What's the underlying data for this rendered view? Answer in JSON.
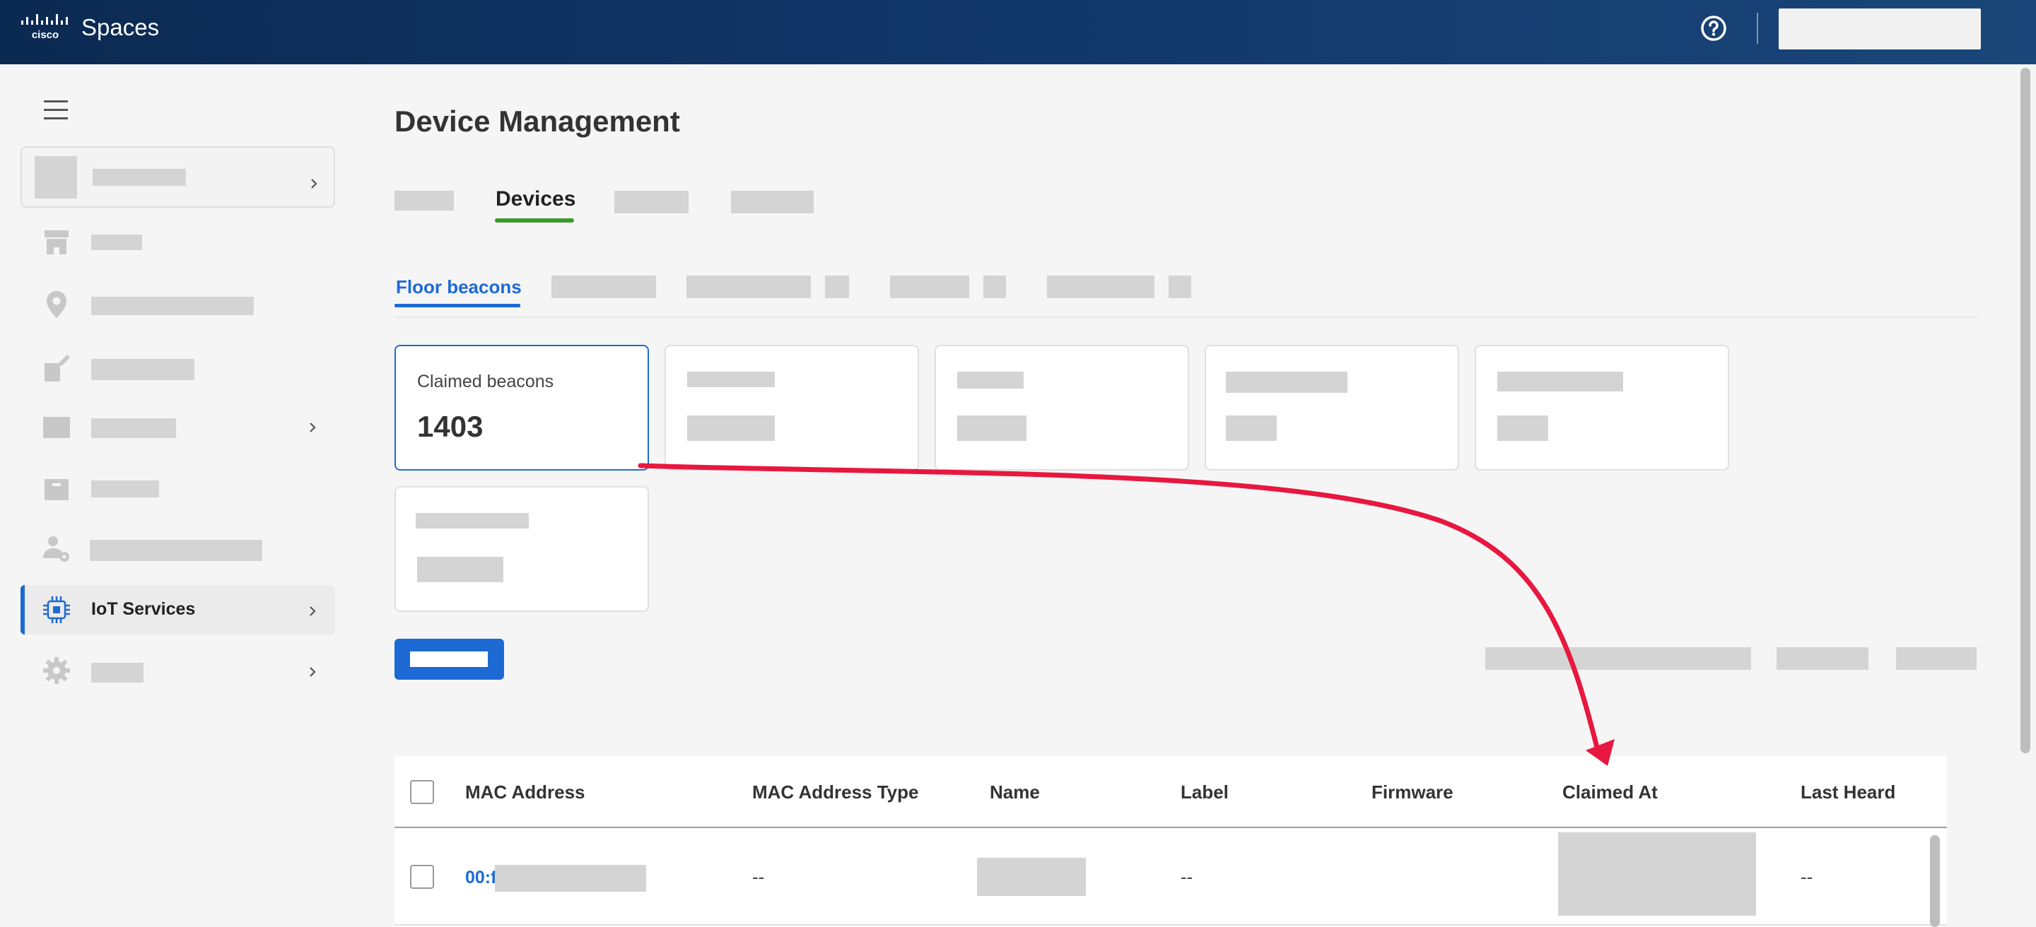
{
  "topbar": {
    "brand": "cisco",
    "app_name": "Spaces",
    "icons": {
      "logo": "cisco-logo",
      "help": "help-circle-icon"
    }
  },
  "sidebar": {
    "icons": [
      "menu-icon",
      "store-icon",
      "location-pin-icon",
      "tag-icon",
      "box-icon",
      "folder-icon",
      "user-settings-icon",
      "iot-chip-icon",
      "gear-icon"
    ],
    "active_item": {
      "label": "IoT Services",
      "icon": "iot-chip-icon"
    }
  },
  "main": {
    "title": "Device Management",
    "tabs": {
      "active": "Devices"
    },
    "subtabs": {
      "active": "Floor beacons"
    },
    "cards": [
      {
        "label": "Claimed beacons",
        "value": "1403"
      }
    ]
  },
  "table": {
    "headers": [
      "MAC Address",
      "MAC Address Type",
      "Name",
      "Label",
      "Firmware",
      "Claimed At",
      "Last Heard"
    ],
    "rows": [
      {
        "mac": "00:f",
        "mac_type": "--",
        "label": "--",
        "last_heard": "--"
      }
    ]
  },
  "colors": {
    "topbar": "#0b2a52",
    "accent_blue": "#1d6ad4",
    "tab_green": "#3a9a2a",
    "annotation_red": "#e8173f"
  }
}
